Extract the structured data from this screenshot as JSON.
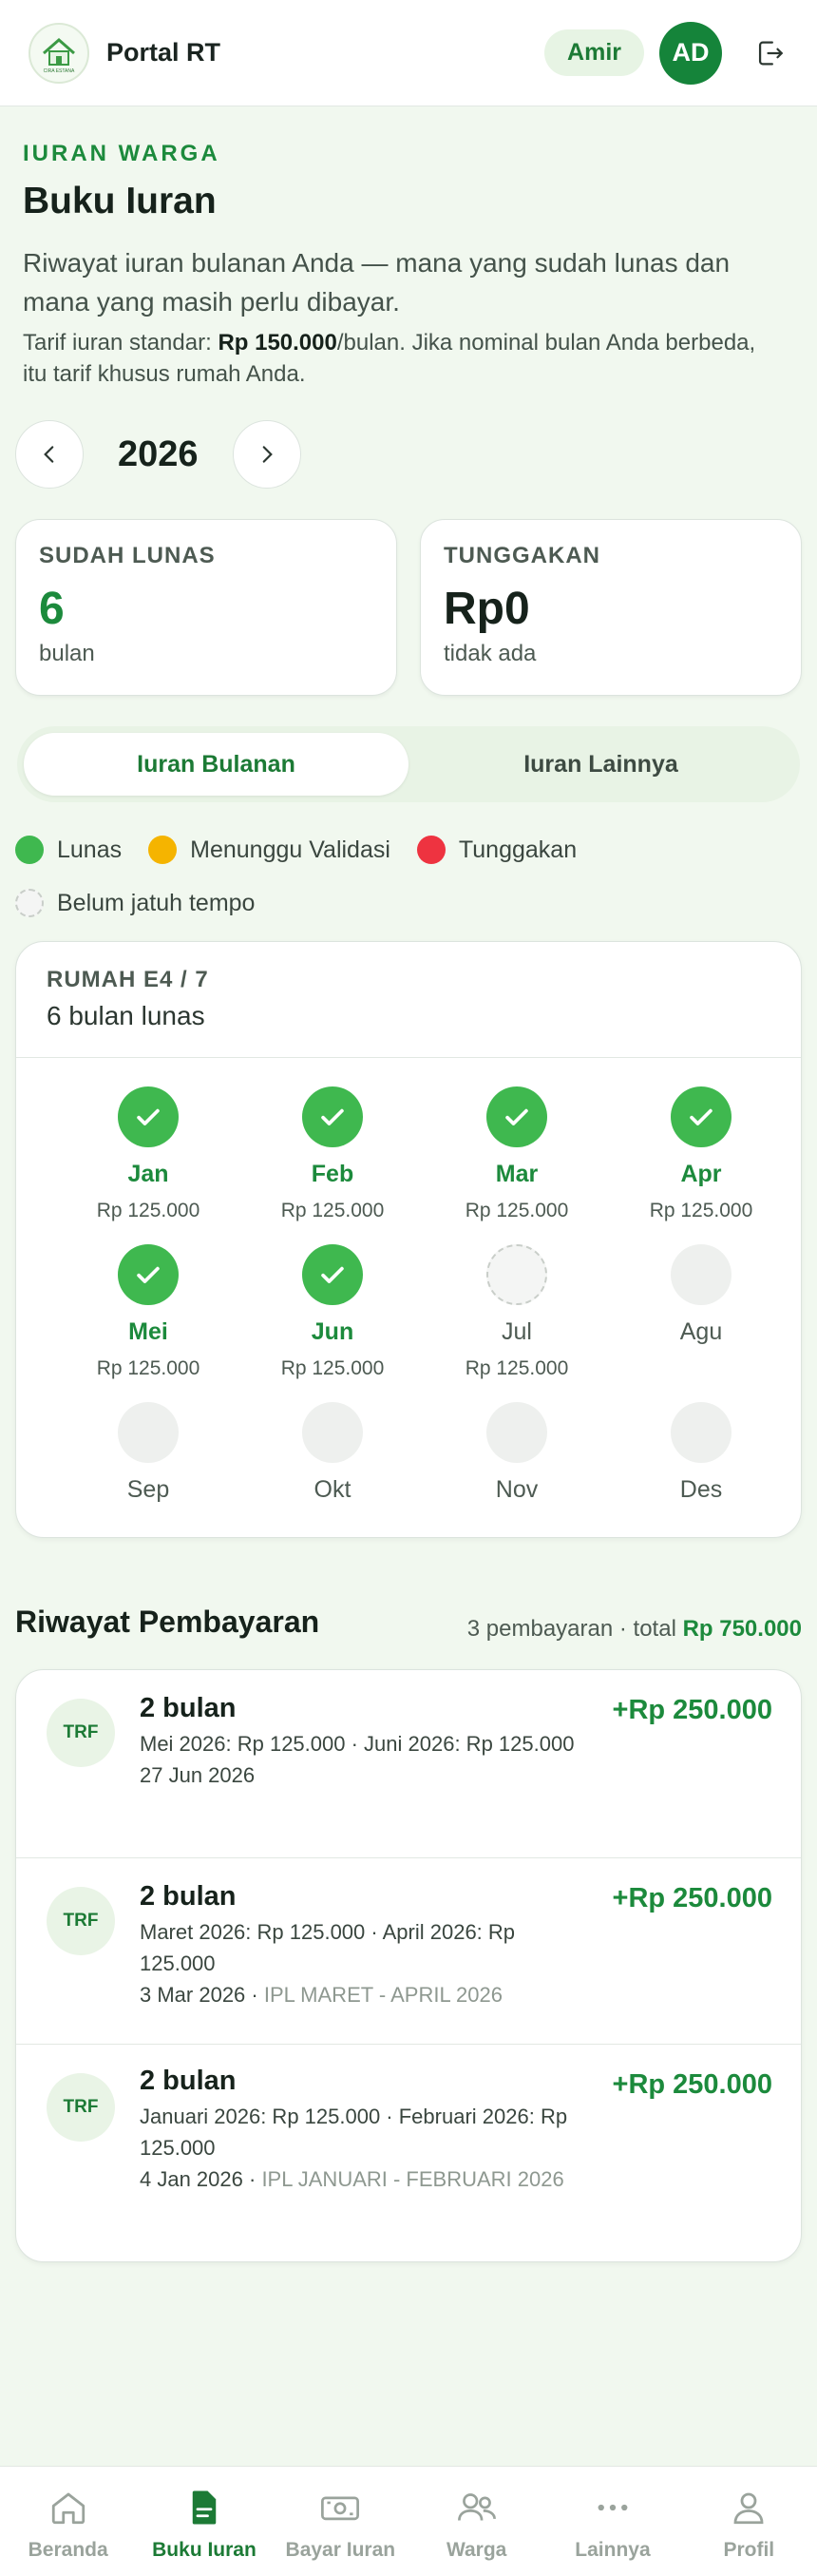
{
  "header": {
    "app_title": "Portal RT",
    "user_name": "Amir",
    "avatar_initials": "AD",
    "logo_text": "CIRA ESTANA"
  },
  "page": {
    "eyebrow": "IURAN WARGA",
    "title": "Buku Iuran",
    "intro": "Riwayat iuran bulanan Anda — mana yang sudah lunas dan mana yang masih perlu dibayar.",
    "tariff_prefix": "Tarif iuran standar: ",
    "tariff_amount": "Rp 150.000",
    "tariff_suffix": "/bulan. Jika nominal bulan Anda berbeda, itu tarif khusus rumah Anda."
  },
  "year_nav": {
    "year": "2026"
  },
  "stats": {
    "paid": {
      "label": "SUDAH LUNAS",
      "value": "6",
      "sub": "bulan"
    },
    "arrears": {
      "label": "TUNGGAKAN",
      "value": "Rp0",
      "sub": "tidak ada"
    }
  },
  "tabs": [
    {
      "label": "Iuran Bulanan",
      "active": true
    },
    {
      "label": "Iuran Lainnya",
      "active": false
    }
  ],
  "legend": {
    "paid": "Lunas",
    "pending": "Menunggu Validasi",
    "arrears": "Tunggakan",
    "not_due": "Belum jatuh tempo"
  },
  "colors": {
    "accent": "#1c8a3c",
    "paid": "#3fb84f",
    "pending": "#f5b400",
    "arrears": "#ee3340"
  },
  "house": {
    "code": "RUMAH E4 / 7",
    "summary": "6 bulan lunas",
    "months": [
      {
        "name": "Jan",
        "amount": "Rp 125.000",
        "status": "paid"
      },
      {
        "name": "Feb",
        "amount": "Rp 125.000",
        "status": "paid"
      },
      {
        "name": "Mar",
        "amount": "Rp 125.000",
        "status": "paid"
      },
      {
        "name": "Apr",
        "amount": "Rp 125.000",
        "status": "paid"
      },
      {
        "name": "Mei",
        "amount": "Rp 125.000",
        "status": "paid"
      },
      {
        "name": "Jun",
        "amount": "Rp 125.000",
        "status": "paid"
      },
      {
        "name": "Jul",
        "amount": "Rp 125.000",
        "status": "upcoming"
      },
      {
        "name": "Agu",
        "amount": "",
        "status": "none"
      },
      {
        "name": "Sep",
        "amount": "",
        "status": "none"
      },
      {
        "name": "Okt",
        "amount": "",
        "status": "none"
      },
      {
        "name": "Nov",
        "amount": "",
        "status": "none"
      },
      {
        "name": "Des",
        "amount": "",
        "status": "none"
      }
    ]
  },
  "history": {
    "title": "Riwayat Pembayaran",
    "meta_prefix": "3 pembayaran · total ",
    "meta_total": "Rp 750.000",
    "items": [
      {
        "method": "TRF",
        "count": "2 bulan",
        "amount": "+Rp 250.000",
        "detail": "Mei 2026: Rp 125.000 · Juni 2026: Rp 125.000",
        "date": "27 Jun 2026",
        "note": ""
      },
      {
        "method": "TRF",
        "count": "2 bulan",
        "amount": "+Rp 250.000",
        "detail": "Maret 2026: Rp 125.000 · April 2026: Rp 125.000",
        "date": "3 Mar 2026",
        "note": "IPL MARET - APRIL 2026"
      },
      {
        "method": "TRF",
        "count": "2 bulan",
        "amount": "+Rp 250.000",
        "detail": "Januari 2026: Rp 125.000 · Februari 2026: Rp 125.000",
        "date": "4 Jan 2026",
        "note": "IPL JANUARI - FEBRUARI 2026"
      }
    ]
  },
  "nav": [
    {
      "label": "Beranda",
      "icon": "home-icon",
      "active": false
    },
    {
      "label": "Buku Iuran",
      "icon": "ledger-icon",
      "active": true
    },
    {
      "label": "Bayar Iuran",
      "icon": "money-icon",
      "active": false
    },
    {
      "label": "Warga",
      "icon": "people-icon",
      "active": false
    },
    {
      "label": "Lainnya",
      "icon": "more-icon",
      "active": false
    },
    {
      "label": "Profil",
      "icon": "profile-icon",
      "active": false
    }
  ]
}
